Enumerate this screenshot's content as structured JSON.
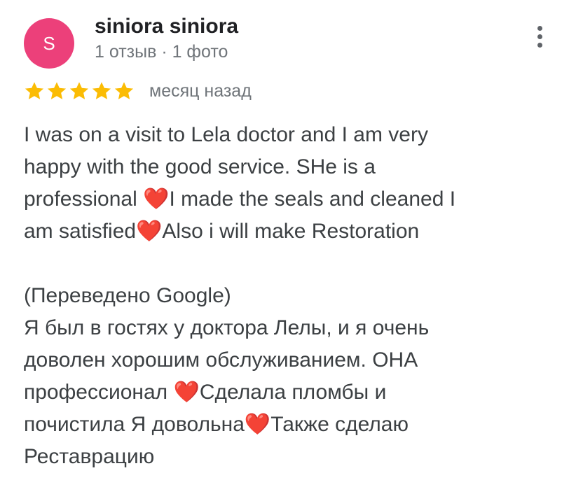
{
  "review": {
    "author": "siniora siniora",
    "avatar_letter": "S",
    "avatar_color": "#ec407a",
    "meta": "1 отзыв · 1 фото",
    "rating": 5,
    "rating_max": 5,
    "star_color": "#fbbc04",
    "date": "месяц назад",
    "menu_icon": "more-vert-icon",
    "original_lines": [
      "I was on a visit to Lela doctor and I am very",
      "happy with the good service.  SHe is a",
      "professional ❤️I made the seals and cleaned I",
      "am satisfied❤️Also i will make Restoration"
    ],
    "translated_label": "(Переведено Google)",
    "translated_lines": [
      "Я был в гостях у доктора Лелы, и я очень",
      "доволен хорошим обслуживанием. ОНА",
      "профессионал ❤️Сделала пломбы и",
      "почистила Я довольна❤️Также сделаю",
      "Реставрацию"
    ]
  }
}
